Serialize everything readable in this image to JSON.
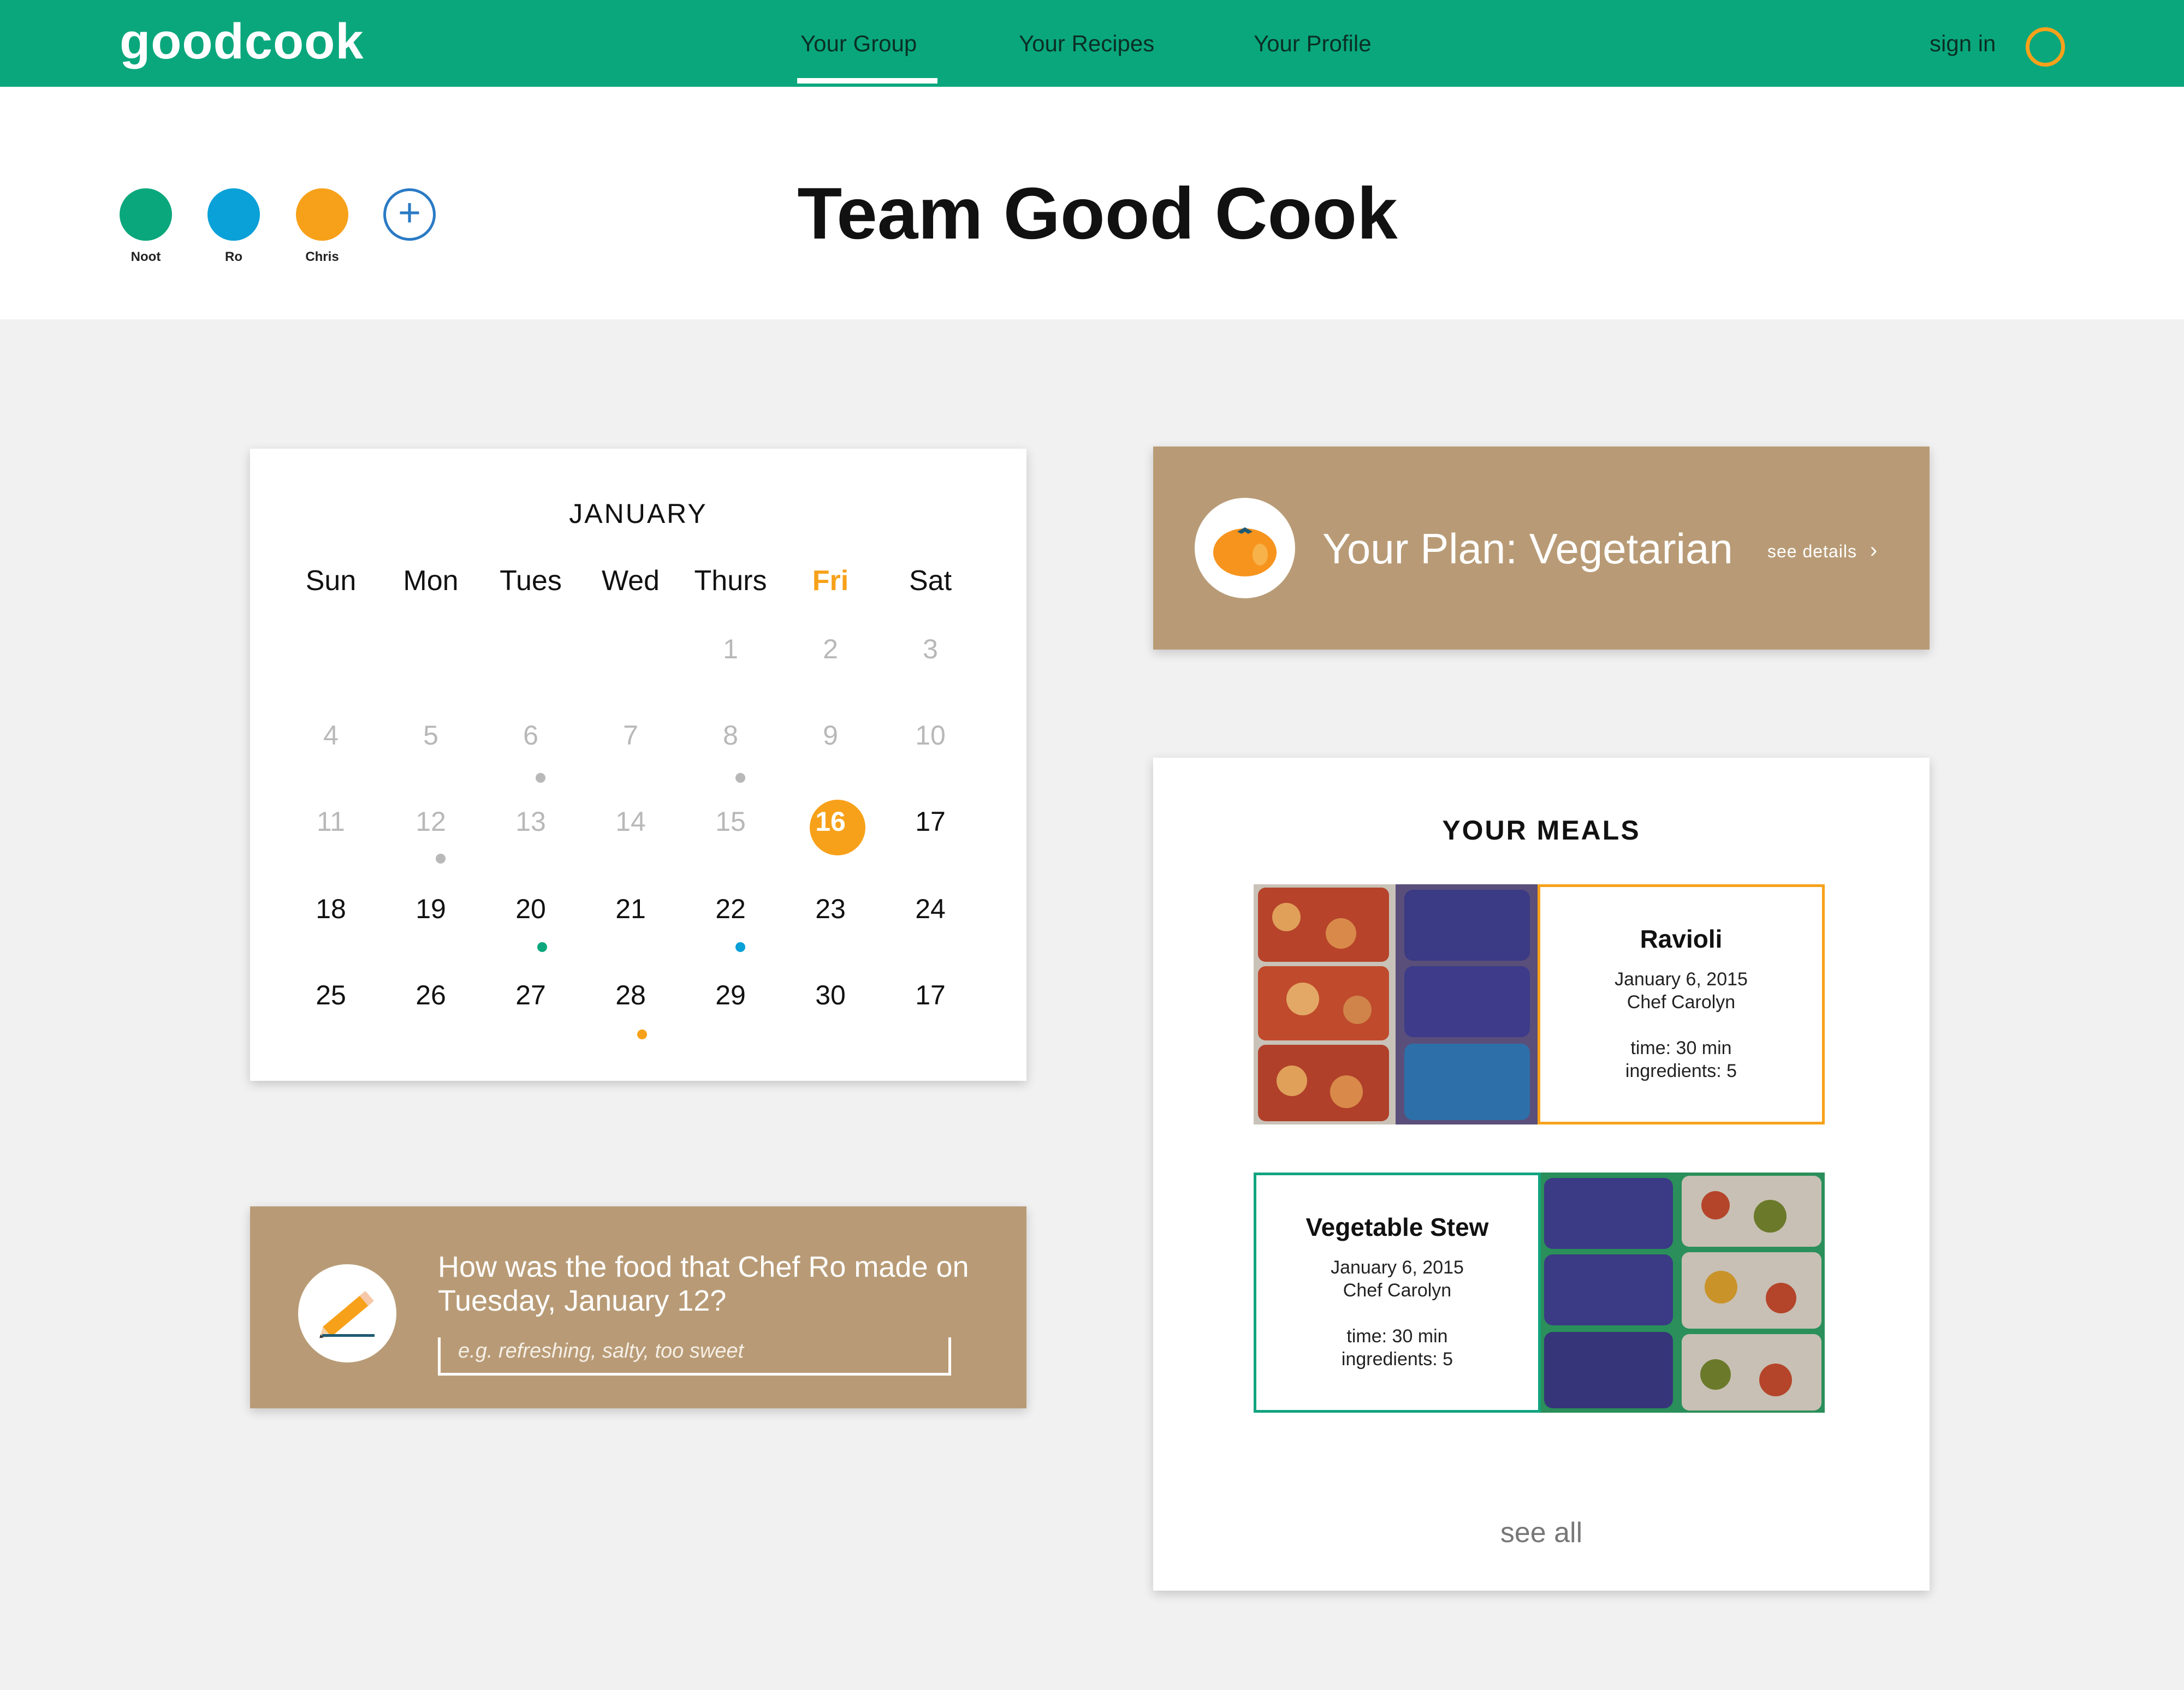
{
  "nav": {
    "logo": "goodcook",
    "tabs": [
      {
        "label": "Your Group",
        "active": true
      },
      {
        "label": "Your Recipes",
        "active": false
      },
      {
        "label": "Your Profile",
        "active": false
      }
    ],
    "signin_label": "sign in"
  },
  "group": {
    "title": "Team Good Cook",
    "members": [
      {
        "name": "Noot",
        "color": "#0aa77c"
      },
      {
        "name": "Ro",
        "color": "#0aa0d8"
      },
      {
        "name": "Chris",
        "color": "#f7a11a"
      }
    ],
    "add_icon": "plus-circle-icon"
  },
  "calendar": {
    "month": "JANUARY",
    "days": [
      "Sun",
      "Mon",
      "Tues",
      "Wed",
      "Thurs",
      "Fri",
      "Sat"
    ],
    "highlight_day": "Fri",
    "today": "16",
    "weeks": [
      [
        "",
        "",
        "",
        "",
        "1",
        "2",
        "3"
      ],
      [
        "4",
        "5",
        "6",
        "7",
        "8",
        "9",
        "10"
      ],
      [
        "11",
        "12",
        "13",
        "14",
        "15",
        "16",
        "17"
      ],
      [
        "18",
        "19",
        "20",
        "21",
        "22",
        "23",
        "24"
      ],
      [
        "25",
        "26",
        "27",
        "28",
        "29",
        "30",
        "17"
      ]
    ],
    "dot_colors": {
      "past": "#b8b8b8",
      "noot": "#0aa77c",
      "ro": "#0aa0d8",
      "chris": "#f7a11a"
    }
  },
  "plan": {
    "title": "Your Plan: Vegetarian",
    "link": "see details",
    "icon": "tomato-icon",
    "color": "#b89b76"
  },
  "feedback": {
    "question": "How was the food that Chef Ro made on Tuesday, January 12?",
    "placeholder": "e.g. refreshing, salty, too sweet",
    "icon": "pencil-icon"
  },
  "meals": {
    "title": "YOUR MEALS",
    "items": [
      {
        "name": "Ravioli",
        "date": "January 6, 2015",
        "chef": "Chef Carolyn",
        "time": "time: 30 min",
        "ingredients": "ingredients: 5"
      },
      {
        "name": "Vegetable Stew",
        "date": "January 6, 2015",
        "chef": "Chef Carolyn",
        "time": "time: 30 min",
        "ingredients": "ingredients: 5"
      }
    ],
    "see_all": "see all"
  }
}
